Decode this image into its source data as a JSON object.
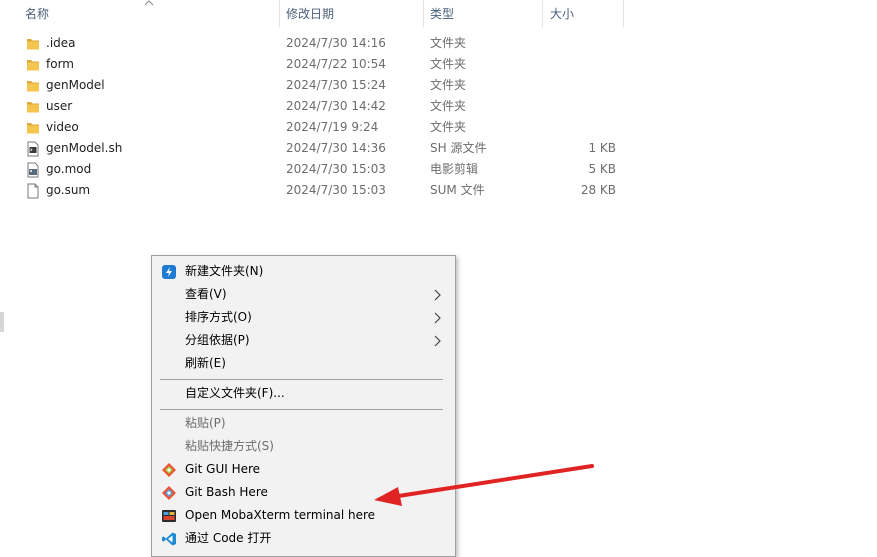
{
  "columns": {
    "name": "名称",
    "date": "修改日期",
    "type": "类型",
    "size": "大小"
  },
  "files": [
    {
      "name": ".idea",
      "date": "2024/7/30 14:16",
      "type": "文件夹",
      "size": "",
      "icon": "folder-icon"
    },
    {
      "name": "form",
      "date": "2024/7/22 10:54",
      "type": "文件夹",
      "size": "",
      "icon": "folder-icon"
    },
    {
      "name": "genModel",
      "date": "2024/7/30 15:24",
      "type": "文件夹",
      "size": "",
      "icon": "folder-icon"
    },
    {
      "name": "user",
      "date": "2024/7/30 14:42",
      "type": "文件夹",
      "size": "",
      "icon": "folder-icon"
    },
    {
      "name": "video",
      "date": "2024/7/19 9:24",
      "type": "文件夹",
      "size": "",
      "icon": "folder-icon"
    },
    {
      "name": "genModel.sh",
      "date": "2024/7/30 14:36",
      "type": "SH 源文件",
      "size": "1 KB",
      "icon": "shell-script-icon"
    },
    {
      "name": "go.mod",
      "date": "2024/7/30 15:03",
      "type": "电影剪辑",
      "size": "5 KB",
      "icon": "media-file-icon"
    },
    {
      "name": "go.sum",
      "date": "2024/7/30 15:03",
      "type": "SUM 文件",
      "size": "28 KB",
      "icon": "blank-file-icon"
    }
  ],
  "context_menu": {
    "new_folder": "新建文件夹(N)",
    "view": "查看(V)",
    "sort_by": "排序方式(O)",
    "group_by": "分组依据(P)",
    "refresh": "刷新(E)",
    "customize_folder": "自定义文件夹(F)...",
    "paste": "粘贴(P)",
    "paste_shortcut": "粘贴快捷方式(S)",
    "git_gui": "Git GUI Here",
    "git_bash": "Git Bash Here",
    "mobaxterm": "Open MobaXterm terminal here",
    "vscode": "通过 Code 打开"
  },
  "colors": {
    "folder": "#f4c64f",
    "menu_bg": "#f2f2f2",
    "annotation_arrow": "#e02424",
    "vscode_blue": "#1f8ad2",
    "git_orange": "#f05033"
  }
}
